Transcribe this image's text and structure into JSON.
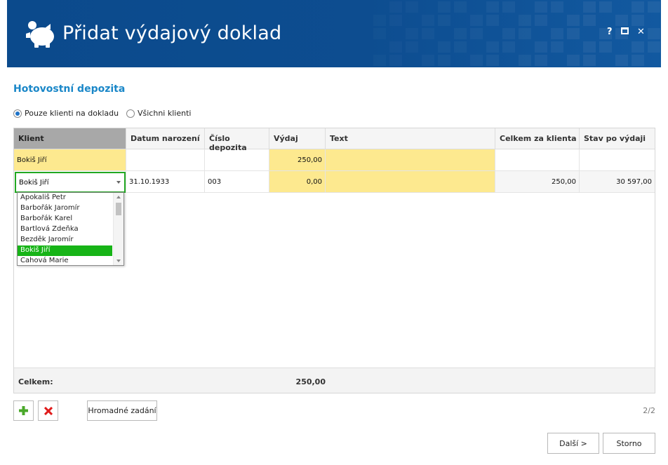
{
  "window": {
    "title": "Přidat výdajový doklad",
    "controls": {
      "help": "?",
      "maximize": "■",
      "close": "✕"
    },
    "accent_color": "#0d4d90"
  },
  "section_title": "Hotovostní depozita",
  "filter": {
    "option_only_clients": "Pouze klienti na dokladu",
    "option_all_clients": "Všichni klienti",
    "selected": "option_only_clients"
  },
  "grid": {
    "columns": [
      "Klient",
      "Datum narození",
      "Číslo depozita",
      "Výdaj",
      "Text",
      "Celkem za klienta",
      "Stav po výdaji"
    ],
    "rows": [
      {
        "client": "Bokiš Jiří",
        "birth": "",
        "deposit": "",
        "expense": "250,00",
        "text": "",
        "total": "",
        "balance": ""
      },
      {
        "client": "Bokiš Jiří",
        "birth": "31.10.1933",
        "deposit": "003",
        "expense": "0,00",
        "text": "",
        "total": "250,00",
        "balance": "30 597,00"
      }
    ],
    "dropdown_items": [
      "Apokališ Petr",
      "Barbořák Jaromír",
      "Barbořák Karel",
      "Bartlová Zdeňka",
      "Bezděk Jaromír",
      "Bokiš Jiří",
      "Cahová Marie"
    ],
    "dropdown_selected": "Bokiš Jiří",
    "total_label": "Celkem:",
    "total_value": "250,00"
  },
  "toolbar": {
    "add_icon": "plus-icon",
    "delete_icon": "delete-icon",
    "bulk_label": "Hromadné zadání",
    "page_indicator": "2/2"
  },
  "footer": {
    "next_label": "Další >",
    "cancel_label": "Storno"
  }
}
